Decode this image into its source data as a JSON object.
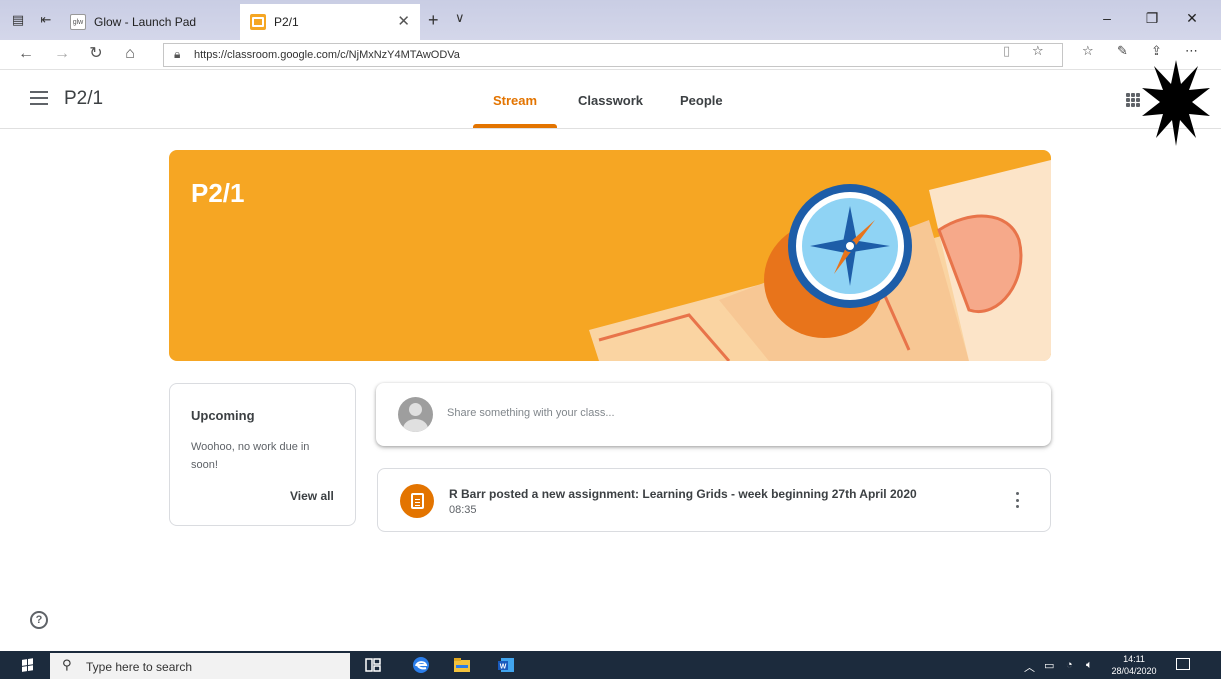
{
  "browser": {
    "tabs": [
      {
        "label": "Glow - Launch Pad",
        "favicon": "glow-icon",
        "active": false
      },
      {
        "label": "P2/1",
        "favicon": "google-classroom-icon",
        "active": true
      }
    ],
    "url": "https://classroom.google.com/c/NjMxNzY4MTAwODVa"
  },
  "app": {
    "class_name": "P2/1",
    "nav": [
      {
        "label": "Stream",
        "active": true
      },
      {
        "label": "Classwork",
        "active": false
      },
      {
        "label": "People",
        "active": false
      }
    ],
    "accent": "#e37400",
    "banner_color": "#f6a623"
  },
  "banner": {
    "title": "P2/1"
  },
  "upcoming": {
    "heading": "Upcoming",
    "message": "Woohoo, no work due in soon!",
    "view_all": "View all"
  },
  "share": {
    "placeholder": "Share something with your class..."
  },
  "post": {
    "title": "R Barr posted a new assignment: Learning Grids - week beginning 27th April 2020",
    "time": "08:35"
  },
  "taskbar": {
    "search_placeholder": "Type here to search",
    "time": "14:11",
    "date": "28/04/2020"
  }
}
